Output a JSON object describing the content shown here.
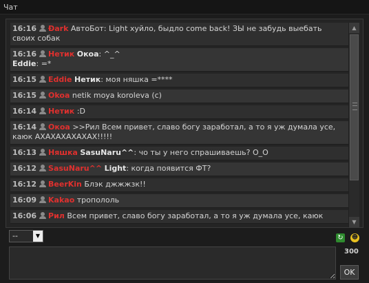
{
  "window": {
    "title": "Чат"
  },
  "messages": [
    {
      "time": "16:16",
      "nick": "Ðark",
      "to": "",
      "text": "АвтоБот: Light хуйло, быдло come back! ЗЫ не забудь выебать своих собак"
    },
    {
      "time": "16:16",
      "nick": "Нетик",
      "to": "Окоа",
      "text": ": ^_^",
      "line2_to": "Eddie",
      "line2_text": ": =*"
    },
    {
      "time": "16:15",
      "nick": "Eddie",
      "to": "Нетик",
      "text": ": моя няшка =****"
    },
    {
      "time": "16:15",
      "nick": "Okoa",
      "to": "",
      "text": "netik moya koroleva (c)"
    },
    {
      "time": "16:14",
      "nick": "Нетик",
      "to": "",
      "text": ":D"
    },
    {
      "time": "16:14",
      "nick": "Окоа",
      "to": "",
      "text": ">>Рил Всем привет, славо богу заработал, а то я уж думала усе, каюк АХАХАХАХАХАХ!!!!!"
    },
    {
      "time": "16:13",
      "nick": "Няшка",
      "to": "SasuNaru^^",
      "text": ": чо ты у него спрашиваешь? О_О"
    },
    {
      "time": "16:12",
      "nick": "SasuNaru^^",
      "to": "Light",
      "text": ": когда появится ФТ?"
    },
    {
      "time": "16:12",
      "nick": "BeerKin",
      "to": "",
      "text": "Блэк джжжзк!!"
    },
    {
      "time": "16:09",
      "nick": "Kakao",
      "to": "",
      "text": "тропололь"
    },
    {
      "time": "16:06",
      "nick": "Рил",
      "to": "",
      "text": "Всем привет, славо богу заработал, а то я уж думала усе, каюк"
    }
  ],
  "controls": {
    "channel_select_value": "--",
    "char_counter": "300",
    "ok_label": "OK",
    "input_value": ""
  },
  "icons": {
    "user": "user-icon",
    "refresh": "refresh-icon",
    "smiley": "smiley-icon"
  },
  "colors": {
    "nick": "#e0302e",
    "background": "#1c1c1c",
    "message_bg": "#2f2f2f"
  }
}
